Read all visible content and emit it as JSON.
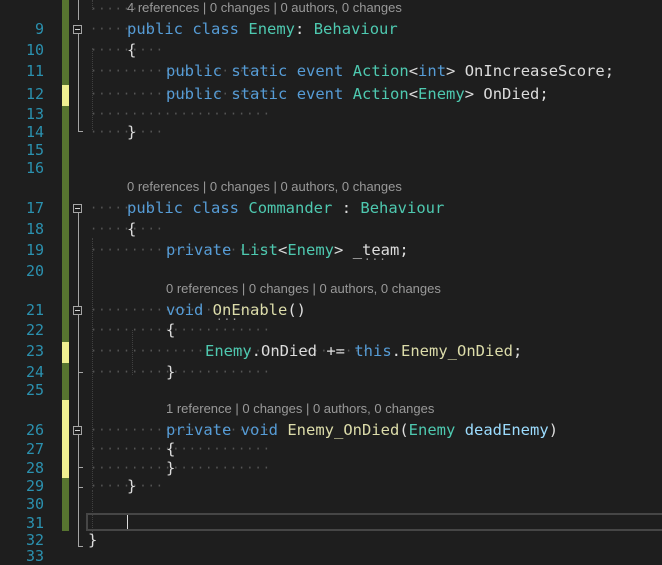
{
  "line_numbers": [
    "9",
    "10",
    "11",
    "12",
    "13",
    "14",
    "15",
    "16",
    "17",
    "18",
    "19",
    "20",
    "21",
    "22",
    "23",
    "24",
    "25",
    "26",
    "27",
    "28",
    "29",
    "30",
    "31",
    "32",
    "33"
  ],
  "code_lens": {
    "enemy_class": "4 references | 0 changes | 0 authors, 0 changes",
    "commander_class": "0 references | 0 changes | 0 authors, 0 changes",
    "on_enable": "0 references | 0 changes | 0 authors, 0 changes",
    "enemy_on_died": "1 reference | 0 changes | 0 authors, 0 changes"
  },
  "code": {
    "l9": {
      "public": "public",
      "class": "class",
      "name": "Enemy",
      "colon": ": ",
      "base": "Behaviour"
    },
    "l10": "{",
    "l11": {
      "public": "public",
      "static": "static",
      "event": "event",
      "action": "Action",
      "lt": "<",
      "type": "int",
      "gt": ">",
      "name": " OnIncreaseScore;"
    },
    "l12": {
      "public": "public",
      "static": "static",
      "event": "event",
      "action": "Action",
      "lt": "<",
      "type": "Enemy",
      "gt": ">",
      "name": " OnDied;"
    },
    "l14": "}",
    "l17": {
      "public": "public",
      "class": "class",
      "name": "Commander",
      "colon": " : ",
      "base": "Behaviour"
    },
    "l18": "{",
    "l19": {
      "private": "private",
      "list": "List",
      "lt": "<",
      "type": "Enemy",
      "gt": ">",
      "name": " _team;"
    },
    "l21": {
      "void": "void",
      "name": "OnEnable",
      "rest": "()"
    },
    "l22": "{",
    "l23": {
      "type": "Enemy",
      "dot1": ".",
      "ev": "OnDied",
      "op": " += ",
      "this": "this",
      "dot2": ".",
      "handler": "Enemy_OnDied",
      "end": ";"
    },
    "l24": "}",
    "l26": {
      "private": "private",
      "void": "void",
      "name": "Enemy_OnDied",
      "open": "(",
      "type": "Enemy",
      "param": "deadEnemy",
      "close": ")"
    },
    "l27": "{",
    "l28": "}",
    "l29": "}",
    "l32": "}"
  },
  "colors": {
    "background": "#1e1e1e",
    "keyword": "#569cd6",
    "type": "#4ec9b0",
    "method": "#dcdcaa",
    "parameter": "#9cdcfe",
    "line_number": "#2b91af",
    "saved_change": "#577430",
    "unsaved_change": "#efef91"
  }
}
